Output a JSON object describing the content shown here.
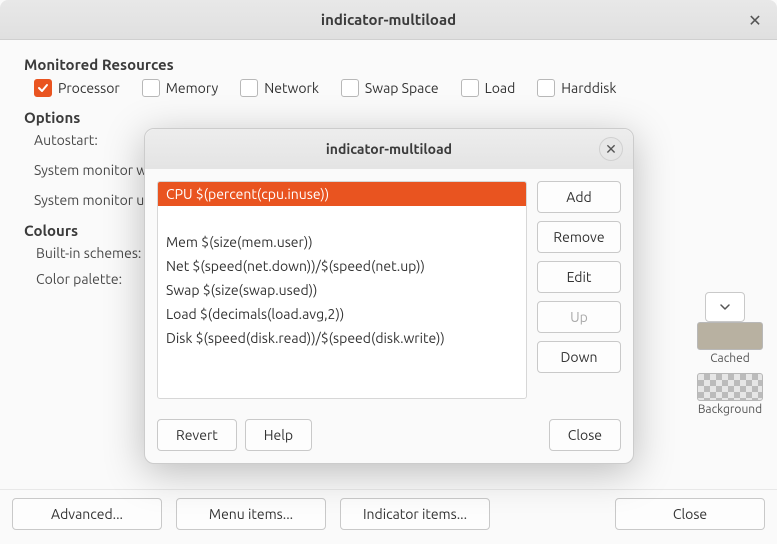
{
  "main": {
    "title": "indicator-multiload",
    "sections": {
      "monitored_label": "Monitored Resources",
      "options_label": "Options",
      "colours_label": "Colours"
    },
    "resources": {
      "processor": "Processor",
      "memory": "Memory",
      "network": "Network",
      "swap": "Swap Space",
      "load": "Load",
      "harddisk": "Harddisk"
    },
    "options": {
      "autostart": "Autostart:",
      "sysmon_width_partial": "System monitor w",
      "sysmon_update_partial": "System monitor u"
    },
    "colours": {
      "schemes": "Built-in schemes:",
      "palette": "Color palette:",
      "swatches": {
        "cached": "Cached",
        "background": "Background"
      }
    },
    "footer": {
      "advanced": "Advanced...",
      "menu_items": "Menu items...",
      "indicator_items": "Indicator items...",
      "close": "Close"
    }
  },
  "dialog": {
    "title": "indicator-multiload",
    "items": [
      {
        "text": "CPU $(percent(cpu.inuse))",
        "selected": true
      },
      {
        "text": "",
        "blank": true
      },
      {
        "text": "Mem $(size(mem.user))"
      },
      {
        "text": "Net $(speed(net.down))/$(speed(net.up))"
      },
      {
        "text": "Swap $(size(swap.used))"
      },
      {
        "text": "Load $(decimals(load.avg,2))"
      },
      {
        "text": "Disk $(speed(disk.read))/$(speed(disk.write))"
      }
    ],
    "buttons": {
      "add": "Add",
      "remove": "Remove",
      "edit": "Edit",
      "up": "Up",
      "down": "Down",
      "revert": "Revert",
      "help": "Help",
      "close": "Close"
    },
    "up_disabled": true
  }
}
